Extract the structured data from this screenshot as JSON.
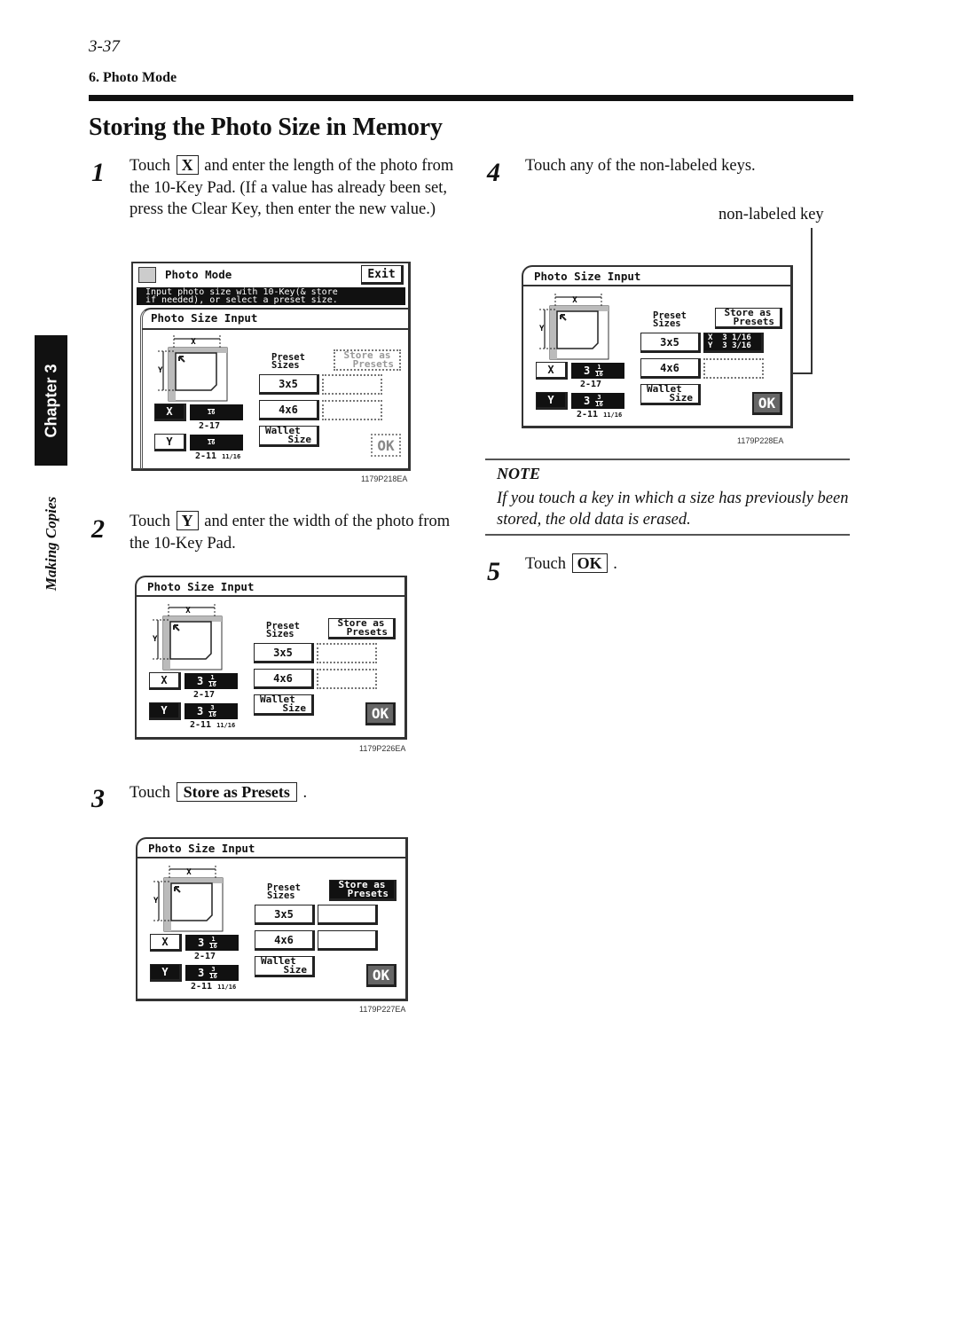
{
  "header": {
    "page_number": "3-37",
    "section": "6. Photo Mode",
    "title": "Storing the Photo Size in Memory"
  },
  "side_tab": {
    "chapter": "Chapter 3",
    "label": "Making Copies"
  },
  "steps": [
    {
      "number": "1",
      "pre": "Touch",
      "key": "X",
      "post": "and enter the length of the photo from the 10-Key Pad. (If a value has already been set, press the Clear Key, then enter the new value.)"
    },
    {
      "number": "2",
      "pre": "Touch",
      "key": "Y",
      "post": "and enter the width of the photo from the 10-Key Pad."
    },
    {
      "number": "3",
      "pre": "Touch",
      "key": "Store as Presets",
      "post": "."
    },
    {
      "number": "4",
      "text": "Touch any of the non-labeled keys."
    },
    {
      "number": "5",
      "pre": "Touch",
      "key": "OK",
      "post": "."
    }
  ],
  "callout": {
    "label": "non-labeled key"
  },
  "note": {
    "title": "NOTE",
    "text": "If you touch a key in which a size has previously been stored, the old data is erased."
  },
  "screens": [
    {
      "figure_code": "1179P218EA",
      "mode_title": "Photo Mode",
      "exit_label": "Exit",
      "message_line1": "Input photo size with 10-Key(& store",
      "message_line2": "if needed), or select a preset size.",
      "panel_title": "Photo Size Input",
      "x_label": "X",
      "y_label": "Y",
      "x_value": "",
      "x_frac_num": "",
      "x_frac_den": "16",
      "y_value": "",
      "y_frac_num": "",
      "y_frac_den": "16",
      "x_range": "2-17",
      "y_range": "2-11",
      "y_range_frac": "11/16",
      "preset_label_1": "Preset",
      "preset_label_2": "Sizes",
      "store_1": "Store as",
      "store_2": "Presets",
      "p1": "3x5",
      "p2": "4x6",
      "wallet_1": "Wallet",
      "wallet_2": "Size",
      "ok": "OK",
      "state": {
        "x_selected": true,
        "y_selected": false,
        "store_enabled": false,
        "store_active": false,
        "ok_enabled": false
      }
    },
    {
      "figure_code": "1179P226EA",
      "panel_title": "Photo Size Input",
      "x_label": "X",
      "y_label": "Y",
      "x_value": "3",
      "x_frac_num": "1",
      "x_frac_den": "16",
      "y_value": "3",
      "y_frac_num": "3",
      "y_frac_den": "16",
      "x_range": "2-17",
      "y_range": "2-11",
      "y_range_frac": "11/16",
      "preset_label_1": "Preset",
      "preset_label_2": "Sizes",
      "store_1": "Store as",
      "store_2": "Presets",
      "p1": "3x5",
      "p2": "4x6",
      "wallet_1": "Wallet",
      "wallet_2": "Size",
      "ok": "OK",
      "state": {
        "x_selected": false,
        "y_selected": true,
        "store_enabled": true,
        "store_active": false,
        "ok_enabled": true
      }
    },
    {
      "figure_code": "1179P227EA",
      "panel_title": "Photo Size Input",
      "x_label": "X",
      "y_label": "Y",
      "x_value": "3",
      "x_frac_num": "1",
      "x_frac_den": "16",
      "y_value": "3",
      "y_frac_num": "3",
      "y_frac_den": "16",
      "x_range": "2-17",
      "y_range": "2-11",
      "y_range_frac": "11/16",
      "preset_label_1": "Preset",
      "preset_label_2": "Sizes",
      "store_1": "Store as",
      "store_2": "Presets",
      "p1": "3x5",
      "p2": "4x6",
      "wallet_1": "Wallet",
      "wallet_2": "Size",
      "ok": "OK",
      "state": {
        "x_selected": false,
        "y_selected": true,
        "store_enabled": true,
        "store_active": true,
        "ok_enabled": true
      }
    },
    {
      "figure_code": "1179P228EA",
      "panel_title": "Photo Size Input",
      "x_label": "X",
      "y_label": "Y",
      "x_value": "3",
      "x_frac_num": "1",
      "x_frac_den": "16",
      "y_value": "3",
      "y_frac_num": "3",
      "y_frac_den": "16",
      "x_range": "2-17",
      "y_range": "2-11",
      "y_range_frac": "11/16",
      "preset_label_1": "Preset",
      "preset_label_2": "Sizes",
      "store_1": "Store as",
      "store_2": "Presets",
      "p1": "3x5",
      "p2": "4x6",
      "wallet_1": "Wallet",
      "wallet_2": "Size",
      "stored_x": "X  3 1/16",
      "stored_y": "Y  3 3/16",
      "ok": "OK",
      "state": {
        "x_selected": false,
        "y_selected": true,
        "store_enabled": true,
        "store_active": false,
        "ok_enabled": true
      }
    }
  ]
}
